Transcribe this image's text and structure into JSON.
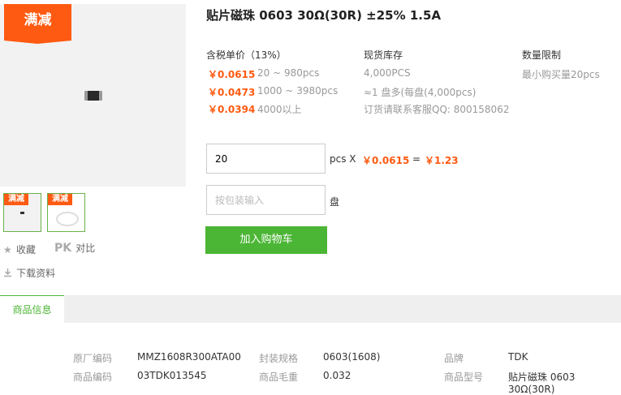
{
  "promo_badge": "满减",
  "thumbnails": [
    {
      "badge": "满减"
    },
    {
      "badge": "满减"
    }
  ],
  "side_links": {
    "favorite": "收藏",
    "pk": "PK",
    "compare": "对比",
    "download": "下载资料"
  },
  "product": {
    "title": "贴片磁珠 0603 30Ω(30R) ±25% 1.5A"
  },
  "pricing": {
    "header": "含税单价（13%）",
    "tiers": [
      {
        "price": "￥0.0615",
        "qty": "20 ~ 980pcs"
      },
      {
        "price": "￥0.0473",
        "qty": "1000 ~ 3980pcs"
      },
      {
        "price": "￥0.0394",
        "qty": "4000以上"
      }
    ]
  },
  "stock": {
    "header": "现货库存",
    "lines": [
      "4,000PCS",
      "≈1 盘多(每盘(4,000pcs)",
      "订货请联系客服QQ: 800158062"
    ]
  },
  "limit": {
    "header": "数量限制",
    "text": "最小购买量20pcs"
  },
  "order": {
    "qty_value": "20",
    "unit_pcs": "pcs X",
    "unit_price": "￥0.0615",
    "equals": "=",
    "total": "￥1.23",
    "reel_placeholder": "按包装输入",
    "unit_reel": "盘",
    "add_to_cart": "加入购物车"
  },
  "tabs": {
    "active": "商品信息"
  },
  "specs": [
    [
      {
        "label": "原厂编码",
        "value": "MMZ1608R300ATA00"
      },
      {
        "label": "封装规格",
        "value": "0603(1608)"
      },
      {
        "label": "品牌",
        "value": "TDK"
      }
    ],
    [
      {
        "label": "商品编码",
        "value": "03TDK013545"
      },
      {
        "label": "商品毛重",
        "value": "0.032"
      },
      {
        "label": "商品型号",
        "value": "贴片磁珠 0603 30Ω(30R)"
      }
    ]
  ],
  "colors": {
    "accent_orange": "#ff5a12",
    "accent_green": "#4bb535"
  }
}
